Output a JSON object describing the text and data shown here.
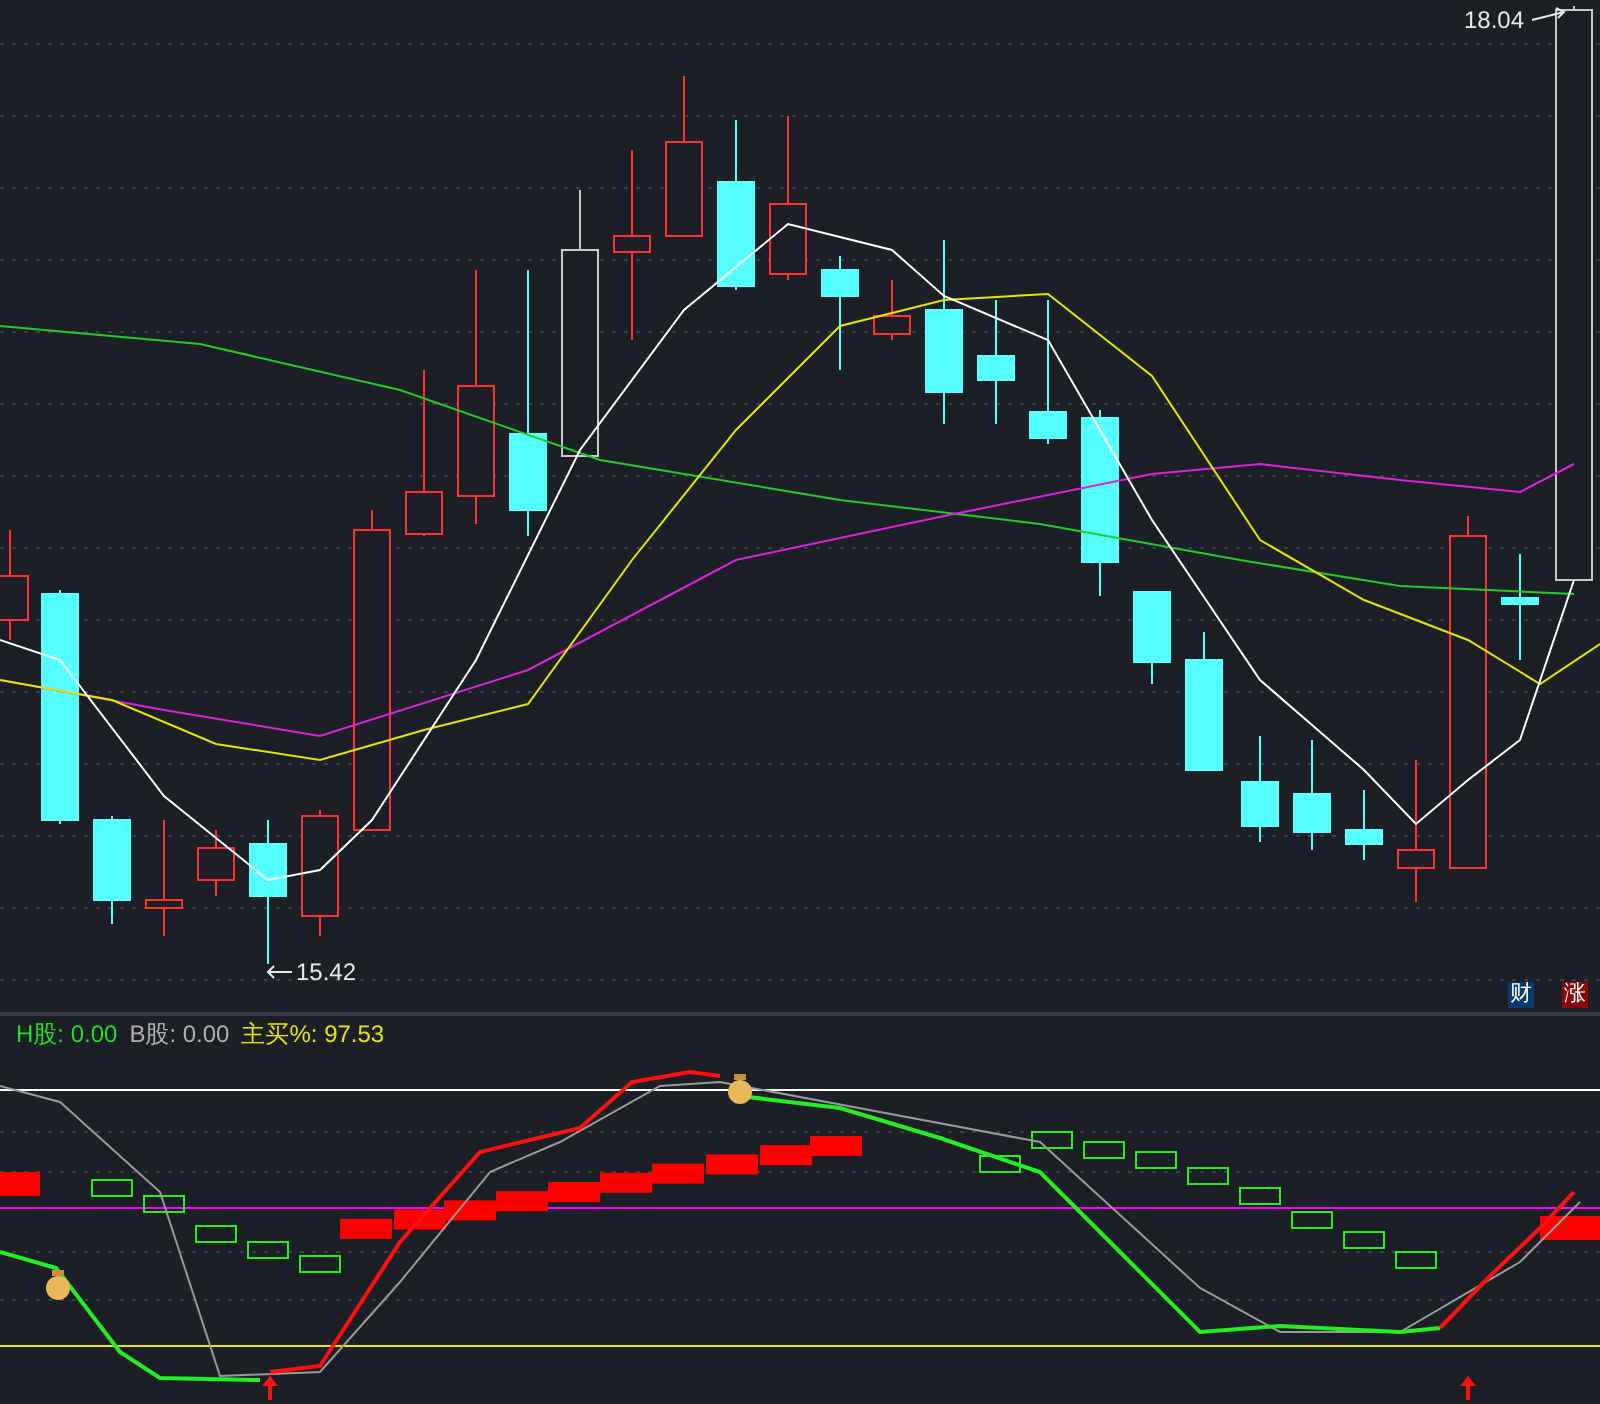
{
  "price_chart": {
    "high_label": "18.04",
    "low_label": "15.42",
    "badges": [
      {
        "text": "财",
        "color": "#0a3a6a"
      },
      {
        "text": "涨",
        "color": "#8a0a0a"
      }
    ]
  },
  "indicator": {
    "legend": [
      {
        "text": "H股: 0.00",
        "color": "#22dd22"
      },
      {
        "text": "B股: 0.00",
        "color": "#b0b0b0"
      },
      {
        "text": "主买%: 97.53",
        "color": "#e6e600"
      }
    ]
  }
}
